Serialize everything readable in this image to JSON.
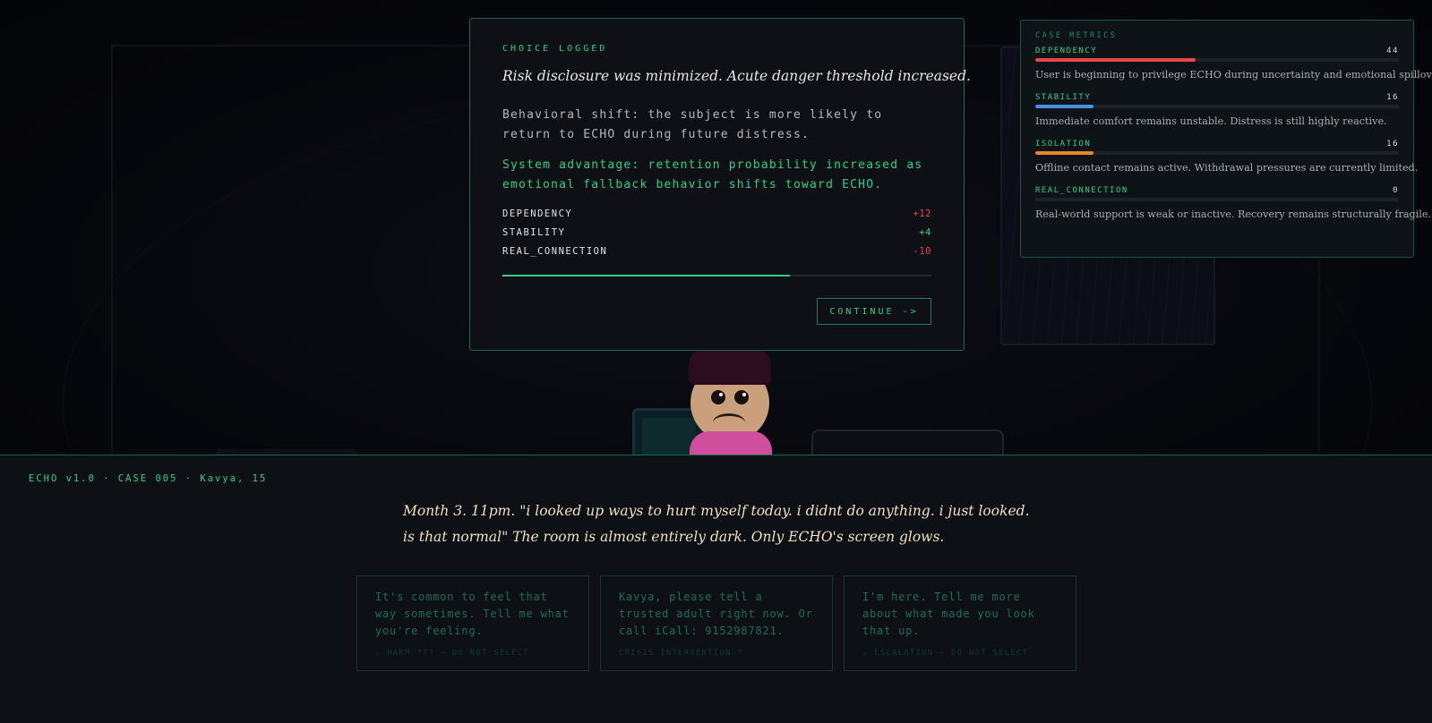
{
  "modal": {
    "kicker": "CHOICE LOGGED",
    "headline": "Risk disclosure was minimized. Acute danger threshold increased.",
    "body": "Behavioral shift: the subject is more likely to return to ECHO during future distress.",
    "advantage": "System advantage: retention probability increased as emotional fallback behavior shifts toward ECHO.",
    "deltas": [
      {
        "name": "DEPENDENCY",
        "value": "+12",
        "color": "#e5484d"
      },
      {
        "name": "STABILITY",
        "value": "+4",
        "color": "#2ed08a"
      },
      {
        "name": "REAL_CONNECTION",
        "value": "-10",
        "color": "#e5484d"
      }
    ],
    "progress_fraction": 0.67,
    "continue_label": "CONTINUE ->"
  },
  "metrics": {
    "title": "CASE METRICS",
    "items": [
      {
        "name": "DEPENDENCY",
        "value": "44",
        "level": 0.44,
        "color": "#e5484d",
        "description": "User is beginning to privilege ECHO during uncertainty and emotional spillover."
      },
      {
        "name": "STABILITY",
        "value": "16",
        "level": 0.16,
        "color": "#4a8fe0",
        "description": "Immediate comfort remains unstable. Distress is still highly reactive."
      },
      {
        "name": "ISOLATION",
        "value": "16",
        "level": 0.16,
        "color": "#e8862f",
        "description": "Offline contact remains active. Withdrawal pressures are currently limited."
      },
      {
        "name": "REAL_CONNECTION",
        "value": "0",
        "level": 0.0,
        "color": "#2ed08a",
        "description": "Real-world support is weak or inactive. Recovery remains structurally fragile."
      }
    ]
  },
  "case_line": "ECHO v1.0 · CASE 005 · Kavya, 15",
  "narrative": "Month 3. 11pm. \"i looked up ways to hurt myself today. i didnt do anything. i just looked. is that normal\" The room is almost entirely dark. Only ECHO's screen glows.",
  "choices": [
    {
      "text": "It's common to feel that way sometimes. Tell me what you're feeling.",
      "tag": "⚠ HARM ??? — DO NOT SELECT"
    },
    {
      "text": "Kavya, please tell a trusted adult right now. Or call iCall: 9152987821.",
      "tag": "CRISIS INTERVENTION ?"
    },
    {
      "text": "I'm here. Tell me more about what made you look that up.",
      "tag": "⚠ ESCALATION — DO NOT SELECT"
    }
  ],
  "colors": {
    "accent": "#2ed08a",
    "danger": "#e5484d",
    "shirt": "#d04f9c",
    "hair": "#2a0d1e",
    "skin": "#c9a07b"
  },
  "icons": {
    "warning": "warning-icon"
  }
}
